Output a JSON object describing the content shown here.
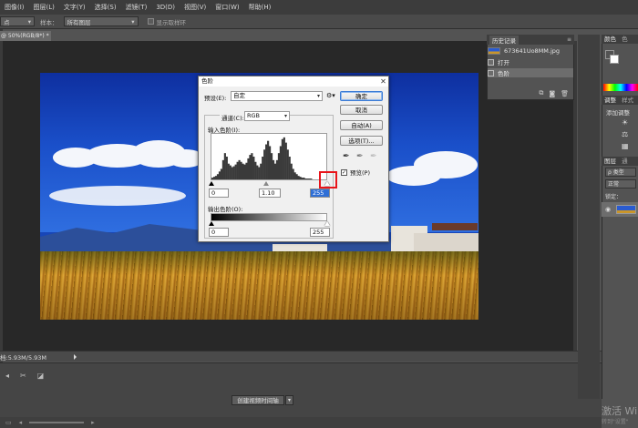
{
  "menubar": {
    "items": [
      "图像(I)",
      "图层(L)",
      "文字(Y)",
      "选择(S)",
      "滤镜(T)",
      "3D(D)",
      "视图(V)",
      "窗口(W)",
      "帮助(H)"
    ]
  },
  "options": {
    "left_select": "点",
    "sample_label": "样本：",
    "sample_value": "所有图层",
    "show_ring": "显示取样环"
  },
  "doc_tab": "@ 50%(RGB/8*) *",
  "status": {
    "doc_info": "档:5.93M/5.93M"
  },
  "timeline": {
    "create_button": "创建视频时间轴",
    "arrow": "▾"
  },
  "watermark": {
    "line1": "激活 Win",
    "line2": "转到\"设置\""
  },
  "history": {
    "title": "历史记录",
    "rows": [
      {
        "label": "673641Uo8MM.jpg",
        "kind": "thumb"
      },
      {
        "label": "打开",
        "kind": "step"
      },
      {
        "label": "色阶",
        "kind": "step",
        "selected": true
      }
    ]
  },
  "right_panels": {
    "color_tab": "颜色",
    "color_tab2": "色",
    "adjust_tab": "调整",
    "style_tab": "样式",
    "add_adjust": "添加调整",
    "layers_tab": "图层",
    "layers_tab2": "通",
    "kind": "ρ 类型",
    "normal": "正常",
    "lock": "锁定：",
    "fg_color": "#1a6bd6",
    "bg_color": "#ffffff"
  },
  "levels_dialog": {
    "title": "色阶",
    "close": "✕",
    "preset_label": "预设(E):",
    "preset_value": "自定",
    "channel_label": "通道(C):",
    "channel_value": "RGB",
    "input_label": "输入色阶(I):",
    "input_black": "0",
    "input_mid": "1.10",
    "input_white": "255",
    "output_label": "输出色阶(O):",
    "output_black": "0",
    "output_white": "255",
    "btn_ok": "确定",
    "btn_cancel": "取消",
    "btn_auto": "自动(A)",
    "btn_options": "选项(T)...",
    "preview_label": "预览(P)",
    "preview_checked": true,
    "histogram": [
      2,
      3,
      4,
      6,
      9,
      12,
      22,
      30,
      26,
      18,
      16,
      14,
      15,
      17,
      20,
      22,
      20,
      18,
      17,
      19,
      24,
      28,
      30,
      26,
      20,
      16,
      14,
      18,
      26,
      34,
      40,
      44,
      38,
      30,
      22,
      18,
      22,
      30,
      38,
      46,
      48,
      42,
      34,
      26,
      18,
      12,
      8,
      6,
      4,
      3,
      2,
      2,
      1,
      1,
      1,
      1,
      0,
      0,
      0,
      0,
      0,
      0,
      0,
      0
    ]
  }
}
